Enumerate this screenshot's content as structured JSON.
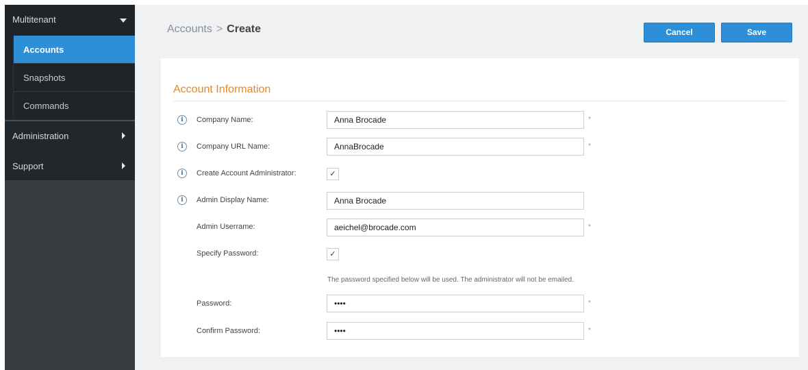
{
  "sidebar": {
    "multitenant": "Multitenant",
    "items": [
      {
        "label": "Accounts"
      },
      {
        "label": "Snapshots"
      },
      {
        "label": "Commands"
      }
    ],
    "administration": "Administration",
    "support": "Support"
  },
  "header": {
    "breadcrumb_parent": "Accounts",
    "breadcrumb_sep": ">",
    "breadcrumb_current": "Create",
    "cancel_label": "Cancel",
    "save_label": "Save"
  },
  "form": {
    "section_title": "Account Information",
    "company_name_label": "Company Name:",
    "company_name_value": "Anna Brocade",
    "company_url_label": "Company URL Name:",
    "company_url_value": "AnnaBrocade",
    "create_admin_label": "Create Account Administrator:",
    "create_admin_checked": "✓",
    "admin_display_label": "Admin Display Name:",
    "admin_display_value": "Anna Brocade",
    "admin_username_label": "Admin Userrame:",
    "admin_username_value": "aeichel@brocade.com",
    "specify_password_label": "Specify Password:",
    "specify_password_checked": "✓",
    "password_note": "The password specified below will be used. The administrator will not be emailed.",
    "password_label": "Password:",
    "password_value": "••••",
    "confirm_password_label": "Confirm Password:",
    "confirm_password_value": "••••",
    "required_mark": "*",
    "info_glyph": "i"
  }
}
